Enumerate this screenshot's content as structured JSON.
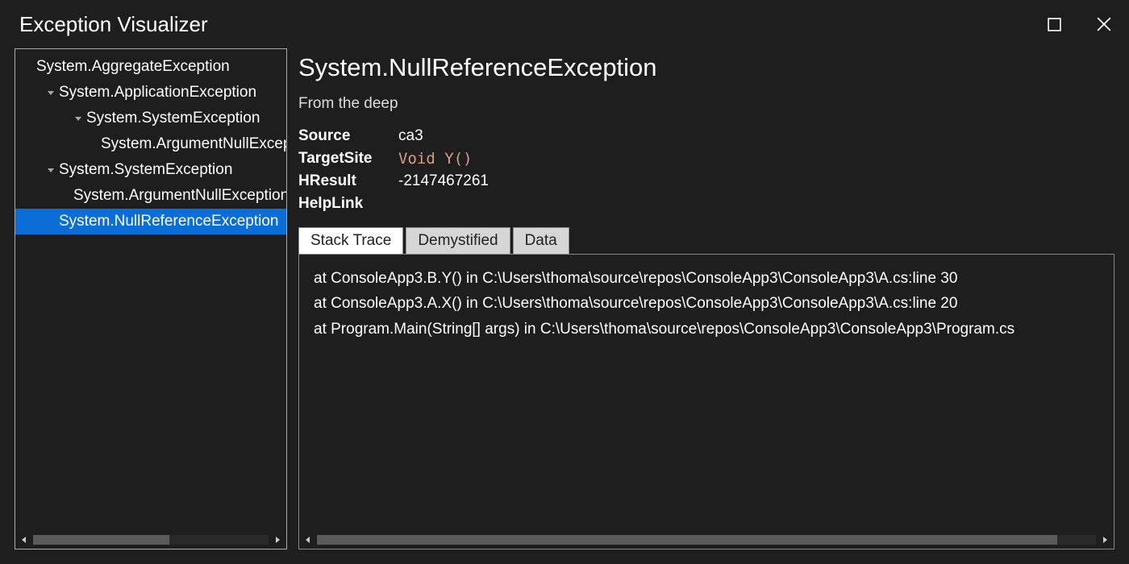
{
  "window": {
    "title": "Exception Visualizer"
  },
  "tree": {
    "items": [
      {
        "label": "System.AggregateException",
        "indent": 0,
        "expanded": null,
        "selected": false
      },
      {
        "label": "System.ApplicationException",
        "indent": 1,
        "expanded": true,
        "selected": false
      },
      {
        "label": "System.SystemException",
        "indent": 2,
        "expanded": true,
        "selected": false
      },
      {
        "label": "System.ArgumentNullException",
        "indent": 3,
        "expanded": null,
        "selected": false
      },
      {
        "label": "System.SystemException",
        "indent": 1,
        "expanded": true,
        "selected": false
      },
      {
        "label": "System.ArgumentNullException",
        "indent": 2,
        "expanded": null,
        "selected": false
      },
      {
        "label": "System.NullReferenceException",
        "indent": 1,
        "expanded": null,
        "selected": true
      }
    ]
  },
  "detail": {
    "title": "System.NullReferenceException",
    "message": "From the deep",
    "props": {
      "source_label": "Source",
      "source_value": "ca3",
      "targetsite_label": "TargetSite",
      "targetsite_value": "Void Y()",
      "hresult_label": "HResult",
      "hresult_value": "-2147467261",
      "helplink_label": "HelpLink",
      "helplink_value": ""
    },
    "tabs": {
      "stack": "Stack Trace",
      "demystified": "Demystified",
      "data": "Data",
      "active": "stack"
    },
    "stack": [
      "   at ConsoleApp3.B.Y() in C:\\Users\\thoma\\source\\repos\\ConsoleApp3\\ConsoleApp3\\A.cs:line 30",
      "   at ConsoleApp3.A.X() in C:\\Users\\thoma\\source\\repos\\ConsoleApp3\\ConsoleApp3\\A.cs:line 20",
      "   at Program.Main(String[] args) in C:\\Users\\thoma\\source\\repos\\ConsoleApp3\\ConsoleApp3\\Program.cs"
    ]
  }
}
